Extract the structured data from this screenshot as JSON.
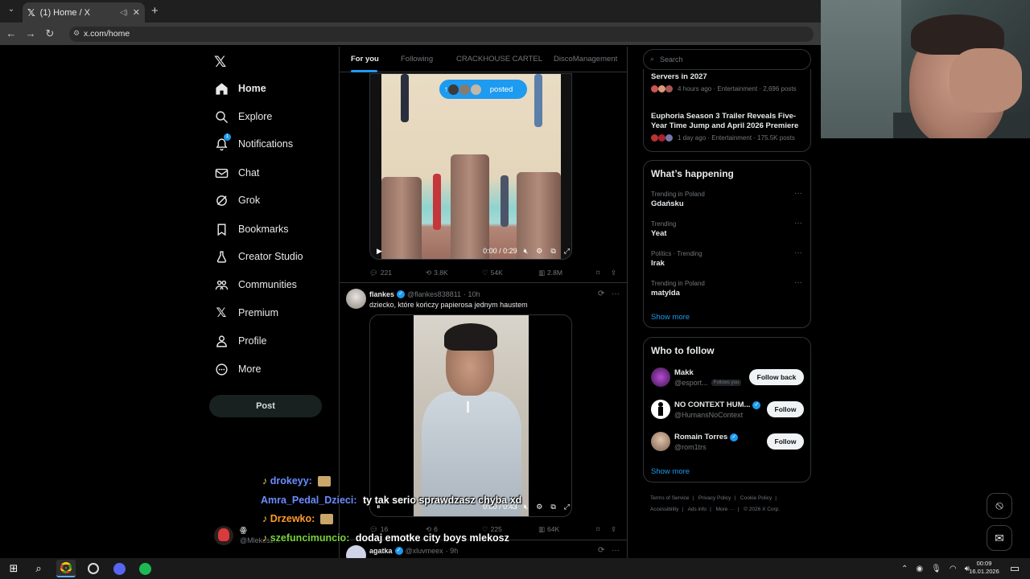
{
  "browser": {
    "tab_title": "(1) Home / X",
    "url": "x.com/home"
  },
  "nav": {
    "items": [
      {
        "label": "Home",
        "icon": "home-icon"
      },
      {
        "label": "Explore",
        "icon": "search-icon"
      },
      {
        "label": "Notifications",
        "icon": "bell-icon"
      },
      {
        "label": "Chat",
        "icon": "mail-icon"
      },
      {
        "label": "Grok",
        "icon": "grok-icon"
      },
      {
        "label": "Bookmarks",
        "icon": "bookmark-icon"
      },
      {
        "label": "Creator Studio",
        "icon": "flask-icon"
      },
      {
        "label": "Communities",
        "icon": "communities-icon"
      },
      {
        "label": "Premium",
        "icon": "x-icon"
      },
      {
        "label": "Profile",
        "icon": "person-icon"
      },
      {
        "label": "More",
        "icon": "more-circle-icon"
      }
    ],
    "post_label": "Post",
    "notification_badge": "1",
    "account_name": "ꙮ",
    "account_handle": "@Mlekosz..."
  },
  "feed": {
    "tabs": [
      "For you",
      "Following",
      "CRACKHOUSE CARTEL",
      "DiscoManagement"
    ],
    "posted_pill": "posted",
    "tweet1": {
      "video_time": "0:00 / 0:29",
      "replies": "221",
      "reposts": "3.8K",
      "likes": "54K",
      "views": "2.8M"
    },
    "tweet2": {
      "name": "flankes",
      "handle": "@flankes838811",
      "time": "· 10h",
      "text": "dziecko, które kończy papierosa jednym haustem",
      "video_time": "0:00 / 0:43",
      "replies": "16",
      "reposts": "6",
      "likes": "225",
      "views": "64K"
    },
    "tweet3": {
      "name": "agatka",
      "handle": "@xluvmeex",
      "time": "· 9h"
    }
  },
  "sidebar": {
    "search_placeholder": "Search",
    "news": [
      {
        "title": "Servers in 2027",
        "meta": "4 hours ago · Entertainment · 2,696 posts"
      },
      {
        "title": "Euphoria Season 3 Trailer Reveals Five-Year Time Jump and April 2026 Premiere",
        "meta": "1 day ago · Entertainment · 175.5K posts"
      }
    ],
    "whats_happening": {
      "title": "What’s happening",
      "trends": [
        {
          "category": "Trending in Poland",
          "name": "Gdańsku"
        },
        {
          "category": "Trending",
          "name": "Yeat"
        },
        {
          "category": "Politics · Trending",
          "name": "Irak"
        },
        {
          "category": "Trending in Poland",
          "name": "matylda"
        }
      ],
      "show_more": "Show more"
    },
    "who_to_follow": {
      "title": "Who to follow",
      "accounts": [
        {
          "name": "Makk",
          "handle": "@esport...",
          "follows_you": "Follows you",
          "button": "Follow back"
        },
        {
          "name": "NO CONTEXT HUM...",
          "handle": "@HumansNoContext",
          "button": "Follow"
        },
        {
          "name": "Romain Torres",
          "handle": "@rom1trs",
          "button": "Follow"
        }
      ],
      "show_more": "Show more"
    },
    "footer": [
      "Terms of Service",
      "Privacy Policy",
      "Cookie Policy",
      "Accessibility",
      "Ads info",
      "More ···",
      "© 2026 X Corp."
    ]
  },
  "chat": [
    {
      "user": "drokeyy:",
      "message": "",
      "color": "#6a8cff"
    },
    {
      "user": "Amra_Pedal_Dzieci:",
      "message": "ty tak serio sprawdzasz chyba xd",
      "color": "#6a8cff"
    },
    {
      "user": "Drzewko:",
      "message": "",
      "color": "#ff9b2b"
    },
    {
      "user": "szefuncimuncio:",
      "message": "dodaj emotke city boys mlekosz",
      "color": "#7ad13a"
    }
  ],
  "taskbar": {
    "time": "00:09",
    "date": "16.01.2026"
  },
  "colors": {
    "accent": "#1d9bf0",
    "background": "#000000",
    "border": "#2f3336"
  }
}
